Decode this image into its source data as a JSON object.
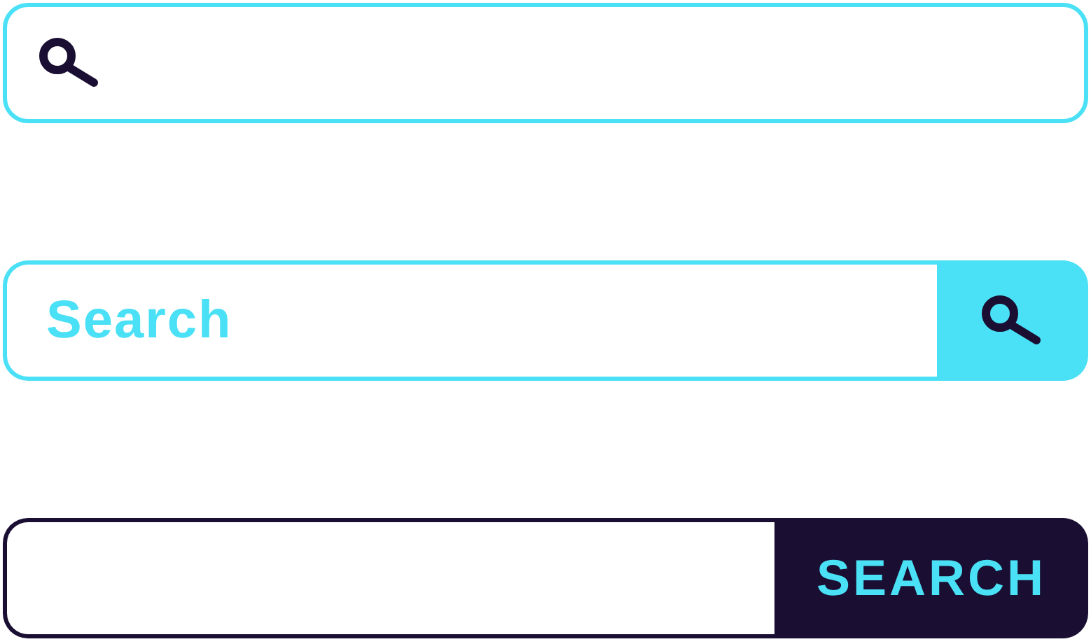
{
  "search_bars": [
    {
      "kind": "icon-field"
    },
    {
      "kind": "icon-button",
      "placeholder": "Search"
    },
    {
      "kind": "text-button",
      "button_label": "SEARCH"
    }
  ]
}
